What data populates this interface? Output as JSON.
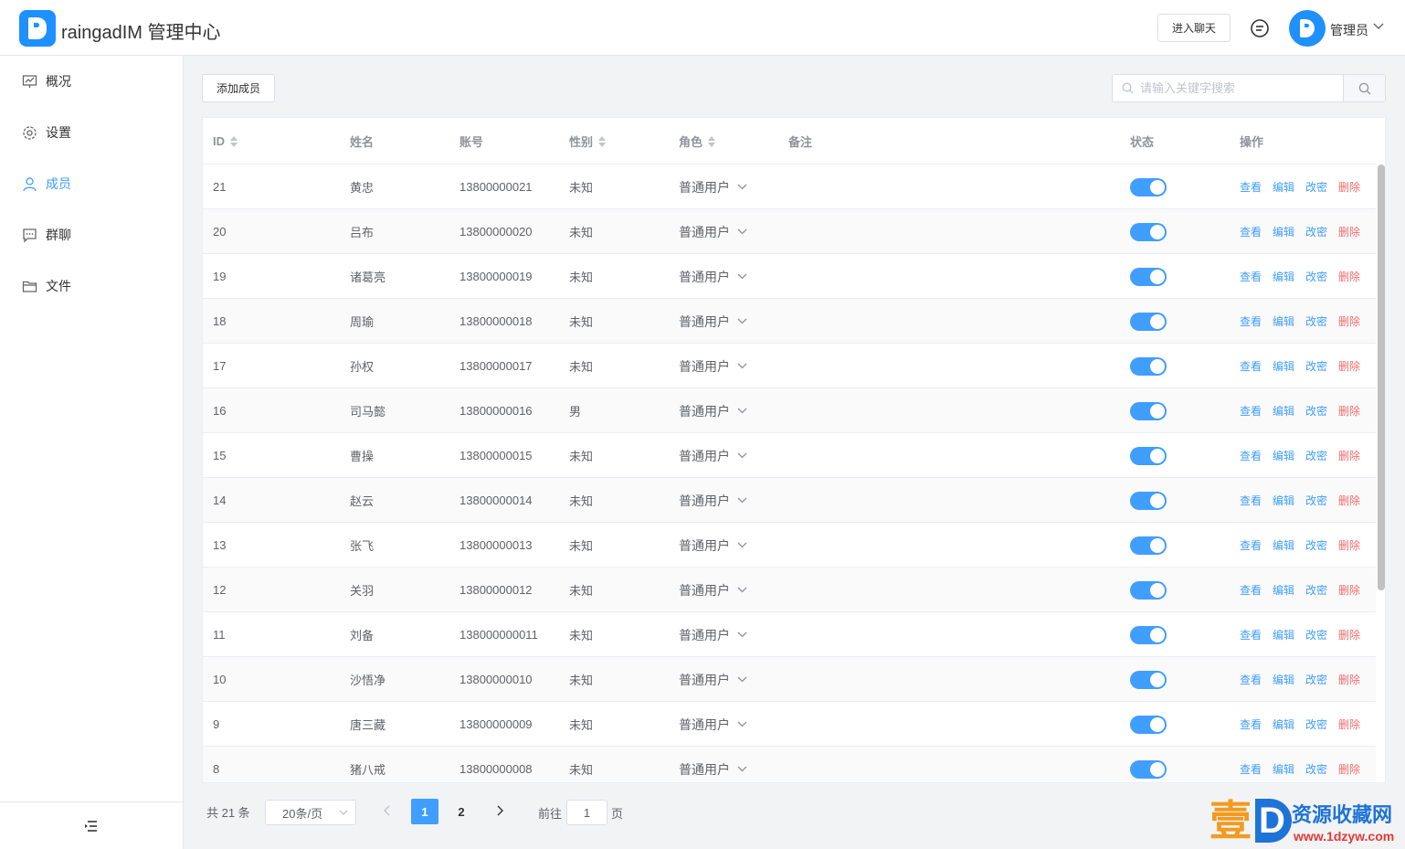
{
  "header": {
    "app_title": "raingadIM 管理中心",
    "enter_chat_label": "进入聊天",
    "admin_name": "管理员"
  },
  "sidebar": {
    "items": [
      {
        "label": "概况",
        "icon": "presentation-icon"
      },
      {
        "label": "设置",
        "icon": "gear-icon"
      },
      {
        "label": "成员",
        "icon": "user-icon",
        "active": true
      },
      {
        "label": "群聊",
        "icon": "chat-bubble-icon"
      },
      {
        "label": "文件",
        "icon": "folder-icon"
      }
    ]
  },
  "toolbar": {
    "add_member_label": "添加成员",
    "search_placeholder": "请输入关键字搜索"
  },
  "table": {
    "columns": {
      "id": "ID",
      "name": "姓名",
      "account": "账号",
      "gender": "性别",
      "role": "角色",
      "remark": "备注",
      "status": "状态",
      "actions": "操作"
    },
    "action_labels": {
      "view": "查看",
      "edit": "编辑",
      "password": "改密",
      "delete": "删除"
    },
    "rows": [
      {
        "id": "21",
        "name": "黄忠",
        "account": "13800000021",
        "gender": "未知",
        "role": "普通用户",
        "remark": "",
        "enabled": true
      },
      {
        "id": "20",
        "name": "吕布",
        "account": "13800000020",
        "gender": "未知",
        "role": "普通用户",
        "remark": "",
        "enabled": true
      },
      {
        "id": "19",
        "name": "诸葛亮",
        "account": "13800000019",
        "gender": "未知",
        "role": "普通用户",
        "remark": "",
        "enabled": true
      },
      {
        "id": "18",
        "name": "周瑜",
        "account": "13800000018",
        "gender": "未知",
        "role": "普通用户",
        "remark": "",
        "enabled": true
      },
      {
        "id": "17",
        "name": "孙权",
        "account": "13800000017",
        "gender": "未知",
        "role": "普通用户",
        "remark": "",
        "enabled": true
      },
      {
        "id": "16",
        "name": "司马懿",
        "account": "13800000016",
        "gender": "男",
        "role": "普通用户",
        "remark": "",
        "enabled": true
      },
      {
        "id": "15",
        "name": "曹操",
        "account": "13800000015",
        "gender": "未知",
        "role": "普通用户",
        "remark": "",
        "enabled": true
      },
      {
        "id": "14",
        "name": "赵云",
        "account": "13800000014",
        "gender": "未知",
        "role": "普通用户",
        "remark": "",
        "enabled": true
      },
      {
        "id": "13",
        "name": "张飞",
        "account": "13800000013",
        "gender": "未知",
        "role": "普通用户",
        "remark": "",
        "enabled": true
      },
      {
        "id": "12",
        "name": "关羽",
        "account": "13800000012",
        "gender": "未知",
        "role": "普通用户",
        "remark": "",
        "enabled": true
      },
      {
        "id": "11",
        "name": "刘备",
        "account": "138000000011",
        "gender": "未知",
        "role": "普通用户",
        "remark": "",
        "enabled": true
      },
      {
        "id": "10",
        "name": "沙悟净",
        "account": "13800000010",
        "gender": "未知",
        "role": "普通用户",
        "remark": "",
        "enabled": true
      },
      {
        "id": "9",
        "name": "唐三藏",
        "account": "13800000009",
        "gender": "未知",
        "role": "普通用户",
        "remark": "",
        "enabled": true
      },
      {
        "id": "8",
        "name": "猪八戒",
        "account": "13800000008",
        "gender": "未知",
        "role": "普通用户",
        "remark": "",
        "enabled": true
      }
    ]
  },
  "pagination": {
    "total_label": "共 21 条",
    "page_size_label": "20条/页",
    "pages": [
      "1",
      "2"
    ],
    "current_page": "1",
    "goto_prefix": "前往",
    "goto_value": "1",
    "goto_suffix": "页"
  },
  "watermark": {
    "big_char": "壹",
    "d_char": "D",
    "cn_text": "资源收藏网",
    "url": "www.1dzyw.com"
  },
  "colors": {
    "accent": "#409eff",
    "danger": "#f56c6c",
    "brand": "#1e90ff"
  }
}
